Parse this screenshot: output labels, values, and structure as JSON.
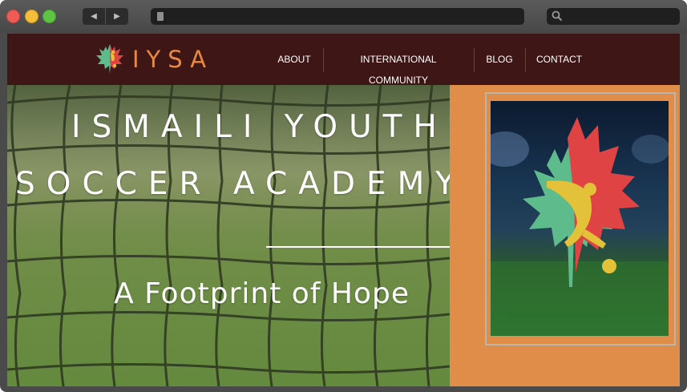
{
  "browser": {
    "back_glyph": "◀",
    "forward_glyph": "▶",
    "icons": [
      "close-light",
      "minimize-light",
      "zoom-light",
      "page-icon",
      "search-icon"
    ]
  },
  "site": {
    "logo_text": "IYSA",
    "nav": [
      {
        "label": "ABOUT"
      },
      {
        "label": "INTERNATIONAL COMMUNITY"
      },
      {
        "label": "BLOG"
      },
      {
        "label": "CONTACT"
      }
    ]
  },
  "hero": {
    "title_line1": "ISMAILI YOUTH",
    "title_line2": "SOCCER ACADEMY",
    "tagline": "A Footprint of Hope"
  },
  "colors": {
    "header_bg": "#3e1616",
    "accent_orange": "#e08d49",
    "logo_orange": "#e9893f",
    "leaf_green": "#5dbb8c",
    "leaf_red": "#e04343",
    "gold": "#e3c23a"
  }
}
